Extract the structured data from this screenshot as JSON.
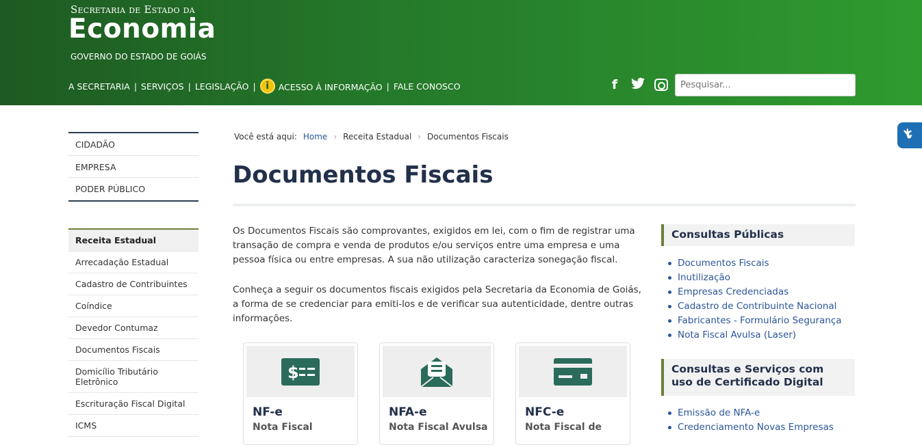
{
  "header": {
    "brand_top": "Secretaria de Estado da",
    "brand_main": "Economia",
    "brand_bottom": "GOVERNO DO ESTADO DE GOIÁS",
    "nav": [
      "A SECRETARIA",
      "SERVIÇOS",
      "LEGISLAÇÃO",
      "ACESSO À INFORMAÇÃO",
      "FALE CONOSCO"
    ],
    "separator": "|",
    "info_badge": "i",
    "social": {
      "facebook": "f",
      "twitter": "t"
    },
    "search_placeholder": "Pesquisar..."
  },
  "sidebar_primary": [
    "CIDADÃO",
    "EMPRESA",
    "PODER PÚBLICO"
  ],
  "sidebar_section": {
    "items": [
      "Receita Estadual",
      "Arrecadação Estadual",
      "Cadastro de Contribuintes",
      "Coíndice",
      "Devedor Contumaz",
      "Documentos Fiscais",
      "Domicílio Tributário Eletrônico",
      "Escrituração Fiscal Digital",
      "ICMS"
    ]
  },
  "breadcrumb": {
    "prefix": "Você está aqui:",
    "items": [
      "Home",
      "Receita Estadual",
      "Documentos Fiscais"
    ]
  },
  "main": {
    "title": "Documentos Fiscais",
    "paragraph1": "Os Documentos Fiscais são comprovantes, exigidos em lei, com o fim de registrar uma transação de compra e venda de produtos e/ou serviços entre uma empresa e uma pessoa física ou entre empresas. A sua não utilização caracteriza sonegação fiscal.",
    "paragraph2": "Conheça a seguir os documentos fiscais exigidos pela Secretaria da Economia de Goiás, a forma de se credenciar para emiti-los e de verificar sua autenticidade, dentre outras informações.",
    "cards": [
      {
        "title": "NF-e",
        "subtitle": "Nota Fiscal",
        "icon": "money-bill-icon"
      },
      {
        "title": "NFA-e",
        "subtitle": "Nota Fiscal Avulsa",
        "icon": "envelope-open-icon"
      },
      {
        "title": "NFC-e",
        "subtitle": "Nota Fiscal de",
        "icon": "credit-card-icon"
      }
    ]
  },
  "right_sidebar": {
    "box1_title": "Consultas Públicas",
    "box1_links": [
      "Documentos Fiscais",
      "Inutilização",
      "Empresas Credenciadas",
      "Cadastro de Contribuinte Nacional",
      "Fabricantes - Formulário Segurança",
      "Nota Fiscal Avulsa (Laser)"
    ],
    "box2_title": "Consultas e Serviços com uso de Certificado Digital",
    "box2_links": [
      "Emissão de NFA-e",
      "Credenciamento Novas Empresas"
    ]
  },
  "colors": {
    "header_dark": "#1e5a22",
    "header_light": "#2f9b2f",
    "title": "#22304a",
    "link": "#2a5599",
    "accent": "#6b7f3a",
    "icon": "#2a6b5a"
  }
}
